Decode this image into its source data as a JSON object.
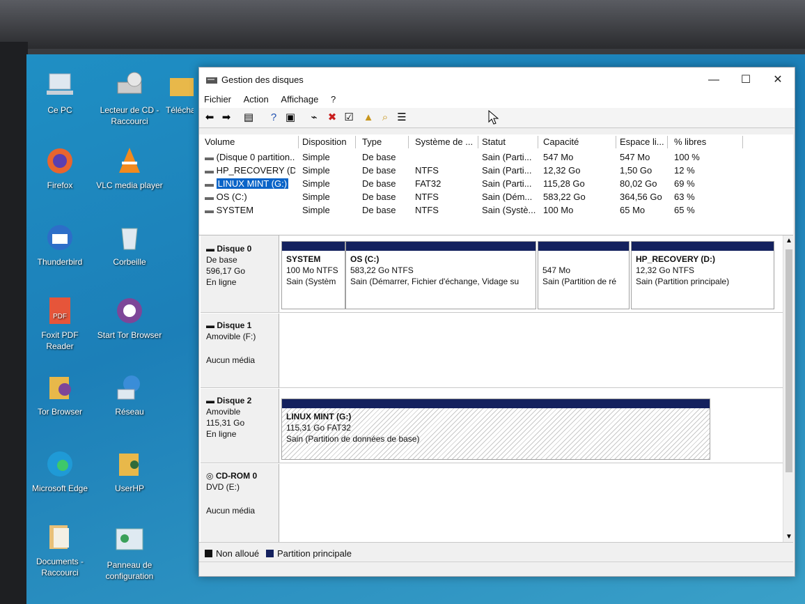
{
  "desktop": {
    "icons": [
      {
        "label": "Ce PC",
        "icon": "computer-icon"
      },
      {
        "label": "Lecteur de CD - Raccourci",
        "icon": "dvd-drive-icon"
      },
      {
        "label": "Téléchar",
        "icon": "folder-icon"
      },
      {
        "label": "Firefox",
        "icon": "firefox-icon"
      },
      {
        "label": "VLC media player",
        "icon": "vlc-icon"
      },
      {
        "label": "Thunderbird",
        "icon": "thunderbird-icon"
      },
      {
        "label": "Corbeille",
        "icon": "recycle-bin-icon"
      },
      {
        "label": "Foxit PDF Reader",
        "icon": "pdf-icon"
      },
      {
        "label": "Start Tor Browser",
        "icon": "tor-icon"
      },
      {
        "label": "Tor Browser",
        "icon": "tor-folder-icon"
      },
      {
        "label": "Réseau",
        "icon": "network-icon"
      },
      {
        "label": "Microsoft Edge",
        "icon": "edge-icon"
      },
      {
        "label": "UserHP",
        "icon": "user-folder-icon"
      },
      {
        "label": "Documents - Raccourci",
        "icon": "documents-icon"
      },
      {
        "label": "Panneau de configuration",
        "icon": "control-panel-icon"
      }
    ]
  },
  "window": {
    "title": "Gestion des disques",
    "controls": {
      "minimize": "—",
      "maximize": "☐",
      "close": "✕"
    }
  },
  "menu": [
    "Fichier",
    "Action",
    "Affichage",
    "?"
  ],
  "toolbar": {
    "icons": [
      "back-arrow-icon",
      "forward-arrow-icon",
      "console-tree-icon",
      "help-icon",
      "view-icon",
      "connect-icon",
      "delete-icon",
      "properties-icon",
      "folder-up-icon",
      "search-folder-icon",
      "list-icon"
    ]
  },
  "volumes": {
    "columns": [
      "Volume",
      "Disposition",
      "Type",
      "Système de ...",
      "Statut",
      "Capacité",
      "Espace li...",
      "% libres"
    ],
    "rows": [
      [
        "(Disque 0 partition...",
        "Simple",
        "De base",
        "",
        "Sain (Parti...",
        "547 Mo",
        "547 Mo",
        "100 %"
      ],
      [
        "HP_RECOVERY (D:)",
        "Simple",
        "De base",
        "NTFS",
        "Sain (Parti...",
        "12,32 Go",
        "1,50 Go",
        "12 %"
      ],
      [
        "LINUX MINT (G:)",
        "Simple",
        "De base",
        "FAT32",
        "Sain (Parti...",
        "115,28 Go",
        "80,02 Go",
        "69 %"
      ],
      [
        "OS (C:)",
        "Simple",
        "De base",
        "NTFS",
        "Sain (Dém...",
        "583,22 Go",
        "364,56 Go",
        "63 %"
      ],
      [
        "SYSTEM",
        "Simple",
        "De base",
        "NTFS",
        "Sain (Systè...",
        "100 Mo",
        "65 Mo",
        "65 %"
      ]
    ]
  },
  "disks": [
    {
      "name": "Disque 0",
      "type": "De base",
      "size": "596,17 Go",
      "status": "En ligne",
      "partitions": [
        {
          "name": "SYSTEM",
          "size": "100 Mo NTFS",
          "status": "Sain (Systèm"
        },
        {
          "name": "OS  (C:)",
          "size": "583,22 Go NTFS",
          "status": "Sain (Démarrer, Fichier d'échange, Vidage su"
        },
        {
          "name": "",
          "size": "547 Mo",
          "status": "Sain (Partition de ré"
        },
        {
          "name": "HP_RECOVERY  (D:)",
          "size": "12,32 Go NTFS",
          "status": "Sain (Partition principale)"
        }
      ]
    },
    {
      "name": "Disque 1",
      "type": "Amovible (F:)",
      "size": "",
      "status": "Aucun média",
      "partitions": []
    },
    {
      "name": "Disque 2",
      "type": "Amovible",
      "size": "115,31 Go",
      "status": "En ligne",
      "partitions": [
        {
          "name": "LINUX MINT  (G:)",
          "size": "115,31 Go FAT32",
          "status": "Sain (Partition de données de base)"
        }
      ]
    },
    {
      "name": "CD-ROM 0",
      "type": "DVD (E:)",
      "size": "",
      "status": "Aucun média",
      "partitions": []
    }
  ],
  "legend": [
    {
      "label": "Non alloué",
      "color": "#111111"
    },
    {
      "label": "Partition principale",
      "color": "#14215e"
    }
  ]
}
